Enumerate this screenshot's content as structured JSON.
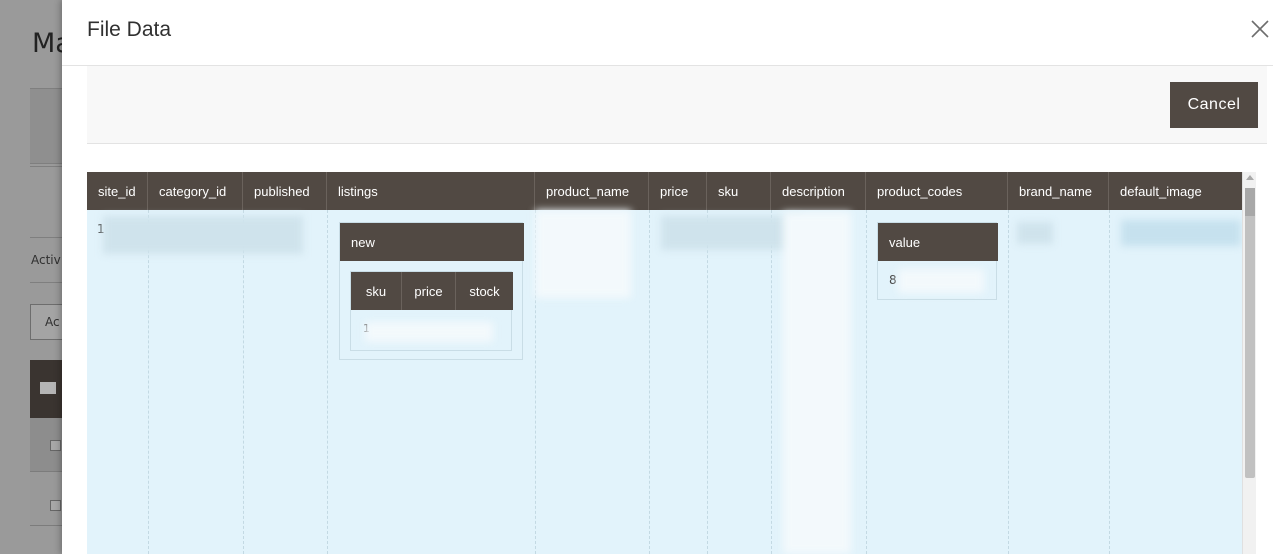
{
  "background": {
    "title": "Ma",
    "active_label": "Activ",
    "action_label": "Ac"
  },
  "modal": {
    "title": "File Data",
    "close_label": "×",
    "cancel_label": "Cancel"
  },
  "grid": {
    "columns": [
      "site_id",
      "category_id",
      "published",
      "listings",
      "product_name",
      "price",
      "sku",
      "description",
      "product_codes",
      "brand_name",
      "default_image"
    ],
    "row_fragment_site_id": "1",
    "listings_nested": {
      "header": "new",
      "columns": [
        "sku",
        "price",
        "stock"
      ],
      "cell_fragment": "1"
    },
    "product_codes_nested": {
      "header": "value",
      "cell_fragment": "8"
    }
  },
  "colors": {
    "header_bg": "#514943",
    "grid_bg": "#e2f3fb",
    "button_bg": "#514943"
  }
}
